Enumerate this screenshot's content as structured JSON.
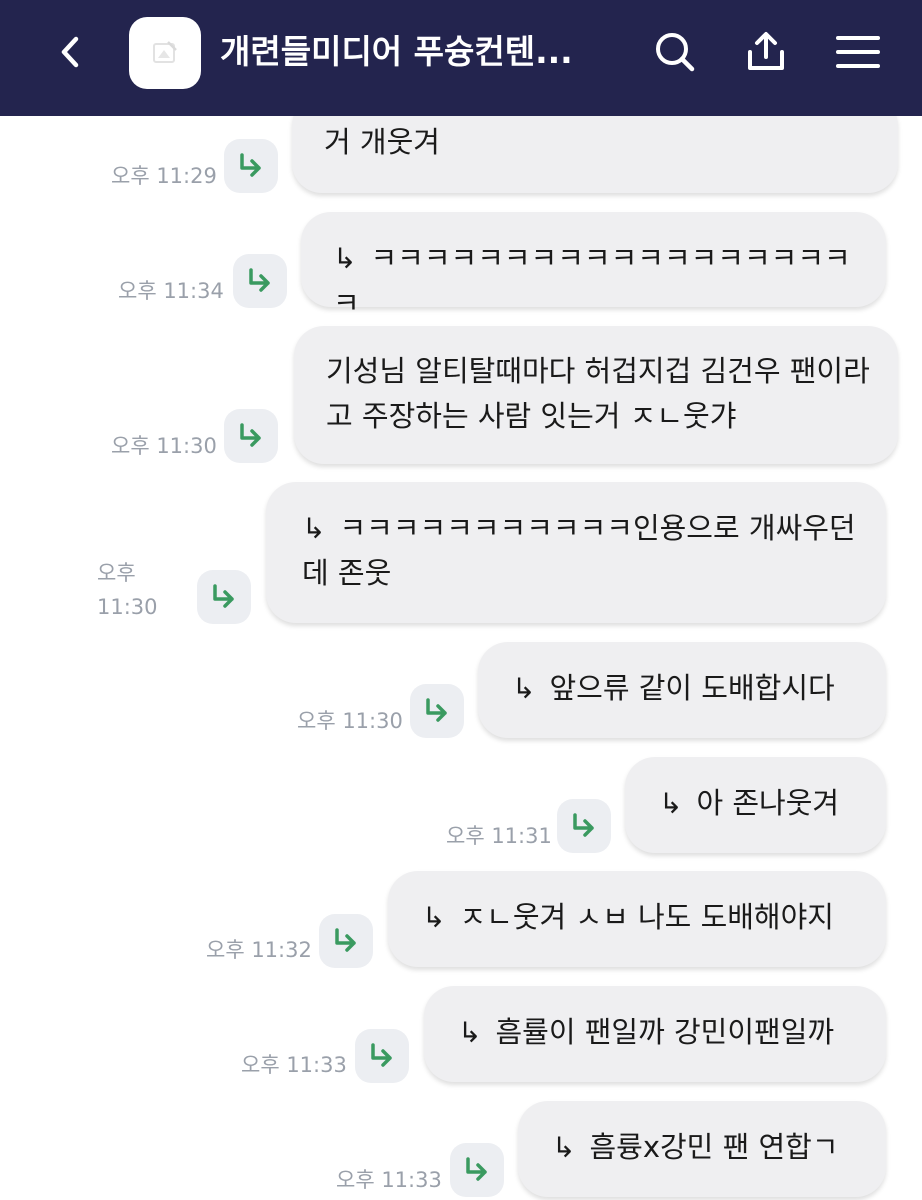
{
  "header": {
    "title": "개련들미디어 푸슝컨텐...",
    "back_icon": "chevron-left-icon",
    "avatar_icon": "room-avatar-icon",
    "search_icon": "search-icon",
    "share_icon": "share-icon",
    "menu_icon": "hamburger-menu-icon",
    "bg_color": "#23244e"
  },
  "reply_prefix": "↳",
  "messages": [
    {
      "text": "거 개웃겨",
      "time": "오후 11:29",
      "reply": false
    },
    {
      "text": "ㅋㅋㅋㅋㅋㅋㅋㅋㅋㅋㅋㅋㅋㅋㅋㅋㅋㅋㅋ",
      "time": "오후 11:34",
      "reply": true
    },
    {
      "text": "기성님 알티탈때마다 허겁지겁 김건우 팬이라고 주장하는 사람 잇는거 ㅈㄴ웃갸",
      "time": "오후 11:30",
      "reply": false
    },
    {
      "text": "ㅋㅋㅋㅋㅋㅋㅋㅋㅋㅋㅋ인용으로 개싸우던데 존웃",
      "time": "오후 11:30",
      "reply": true
    },
    {
      "text": "앞으류 같이 도배합시다",
      "time": "오후 11:30",
      "reply": true
    },
    {
      "text": "아 존나웃겨",
      "time": "오후 11:31",
      "reply": true
    },
    {
      "text": "ㅈㄴ웃겨 ㅅㅂ 나도 도배해야지",
      "time": "오후 11:32",
      "reply": true
    },
    {
      "text": "흠률이 팬일까 강민이팬일까",
      "time": "오후 11:33",
      "reply": true
    },
    {
      "text": "흠륭x강민 팬 연합ㄱ",
      "time": "오후 11:33",
      "reply": true
    }
  ],
  "reply_icon": "reply-arrow-icon",
  "colors": {
    "bubble_bg": "#efeff1",
    "reply_arrow": "#3a9a60",
    "time_text": "#9aa0aa"
  }
}
